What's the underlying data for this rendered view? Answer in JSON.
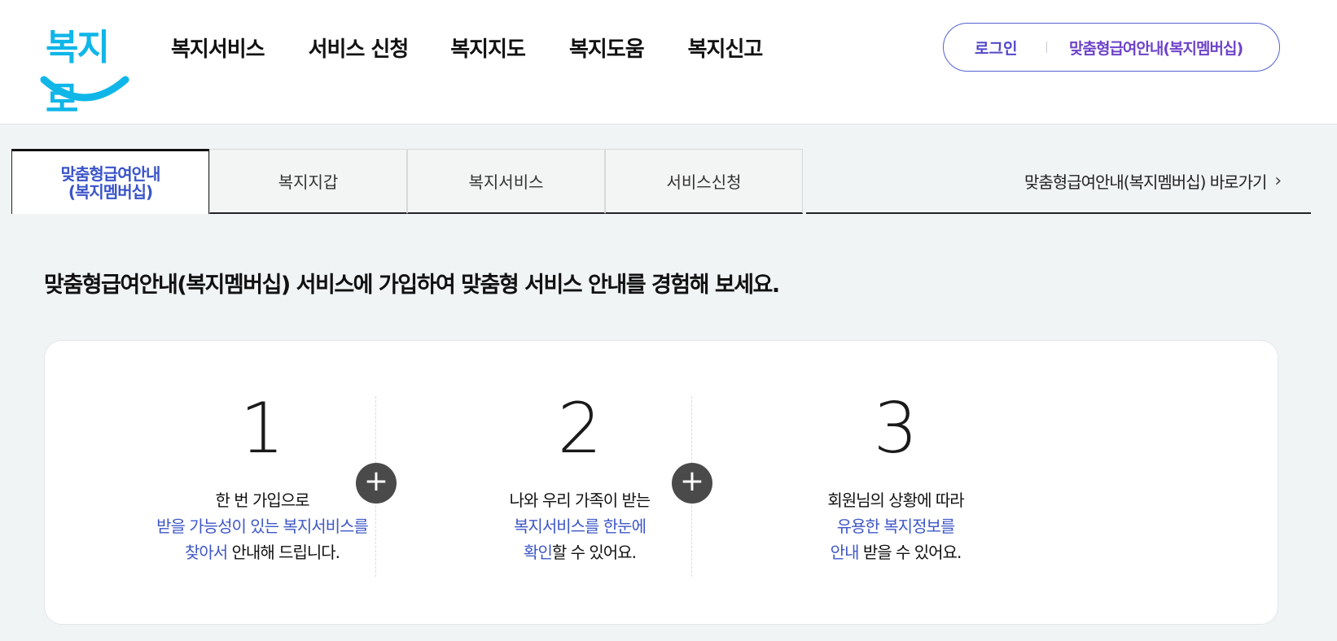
{
  "header": {
    "logo_text": "복지로",
    "nav": [
      "복지서비스",
      "서비스 신청",
      "복지지도",
      "복지도움",
      "복지신고"
    ],
    "auth": {
      "login": "로그인",
      "member": "맞춤형급여안내(복지멤버십)"
    }
  },
  "tabs": {
    "items": [
      {
        "line1": "맞춤형급여안내",
        "line2": "(복지멤버십)"
      },
      {
        "label": "복지지갑"
      },
      {
        "label": "복지서비스"
      },
      {
        "label": "서비스신청"
      }
    ],
    "shortcut": "맞춤형급여안내(복지멤버십) 바로가기",
    "shortcut_icon": "chevron-right-icon"
  },
  "main": {
    "title": "맞춤형급여안내(복지멤버십) 서비스에 가입하여 맞춤형 서비스 안내를 경험해 보세요.",
    "steps": [
      {
        "num": "1",
        "line1": "한 번 가입으로",
        "line2": "받을 가능성이 있는 복지서비스를",
        "line3_hl": "찾아서",
        "line3_rest": " 안내해 드립니다."
      },
      {
        "num": "2",
        "line1": "나와 우리 가족이 받는",
        "line2": "복지서비스를 한눈에",
        "line3_hl": "확인",
        "line3_rest": "할 수 있어요."
      },
      {
        "num": "3",
        "line1": "회원님의 상황에 따라",
        "line2": "유용한 복지정보를",
        "line3_hl": "안내",
        "line3_rest": " 받을 수 있어요."
      }
    ],
    "plus_icon": "plus-icon"
  },
  "colors": {
    "accent": "#3e57c7",
    "logo": "#10b6e8",
    "auth_border": "#5362d1"
  }
}
